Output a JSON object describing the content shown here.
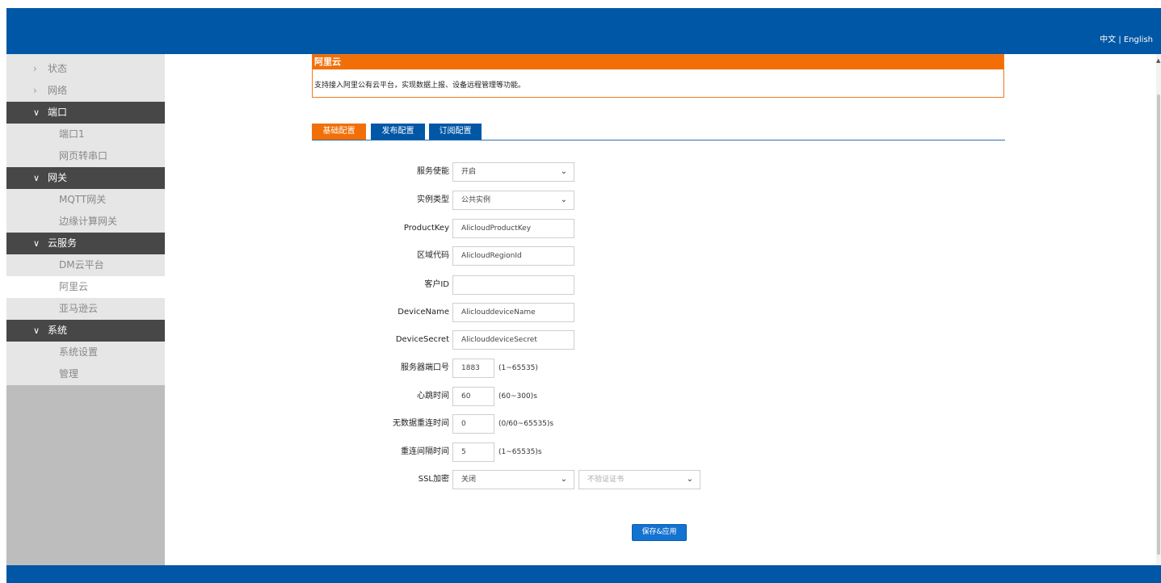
{
  "header": {
    "lang_zh": "中文",
    "lang_sep": "|",
    "lang_en": "English"
  },
  "sidebar": {
    "items": [
      {
        "type": "top",
        "label": "状态"
      },
      {
        "type": "top",
        "label": "网络"
      },
      {
        "type": "group",
        "label": "端口"
      },
      {
        "type": "sub",
        "label": "端口1"
      },
      {
        "type": "sub",
        "label": "网页转串口"
      },
      {
        "type": "group",
        "label": "网关"
      },
      {
        "type": "sub",
        "label": "MQTT网关"
      },
      {
        "type": "sub",
        "label": "边缘计算网关"
      },
      {
        "type": "group",
        "label": "云服务"
      },
      {
        "type": "sub",
        "label": "DM云平台"
      },
      {
        "type": "sub",
        "label": "阿里云",
        "active": true
      },
      {
        "type": "sub",
        "label": "亚马逊云"
      },
      {
        "type": "group",
        "label": "系统"
      },
      {
        "type": "sub",
        "label": "系统设置"
      },
      {
        "type": "sub",
        "label": "管理"
      }
    ]
  },
  "panel": {
    "title": "阿里云",
    "description": "支持接入阿里公有云平台，实现数据上报、设备远程管理等功能。"
  },
  "tabs": [
    {
      "label": "基础配置",
      "active": true
    },
    {
      "label": "发布配置",
      "active": false
    },
    {
      "label": "订阅配置",
      "active": false
    }
  ],
  "form": {
    "service_enable": {
      "label": "服务使能",
      "value": "开启"
    },
    "instance_type": {
      "label": "实例类型",
      "value": "公共实例"
    },
    "product_key": {
      "label": "ProductKey",
      "value": "AlicloudProductKey"
    },
    "region_code": {
      "label": "区域代码",
      "value": "AlicloudRegionId"
    },
    "client_id": {
      "label": "客户ID",
      "value": ""
    },
    "device_name": {
      "label": "DeviceName",
      "value": "AliclouddeviceName"
    },
    "device_secret": {
      "label": "DeviceSecret",
      "value": "AliclouddeviceSecret"
    },
    "server_port": {
      "label": "服务器端口号",
      "value": "1883",
      "hint": "(1~65535)"
    },
    "heartbeat": {
      "label": "心跳时间",
      "value": "60",
      "hint": "(60~300)s"
    },
    "no_data_reconnect": {
      "label": "无数据重连时间",
      "value": "0",
      "hint": "(0/60~65535)s"
    },
    "reconnect_interval": {
      "label": "重连间隔时间",
      "value": "5",
      "hint": "(1~65535)s"
    },
    "ssl": {
      "label": "SSL加密",
      "value": "关闭",
      "cert_value": "不验证证书"
    }
  },
  "actions": {
    "save_apply": "保存&应用"
  },
  "colors": {
    "brand_blue": "#0057a6",
    "accent_orange": "#f26f08",
    "nav_dark": "#474747"
  },
  "icons": {
    "chevron_right": "›",
    "chevron_down": "⌄"
  }
}
